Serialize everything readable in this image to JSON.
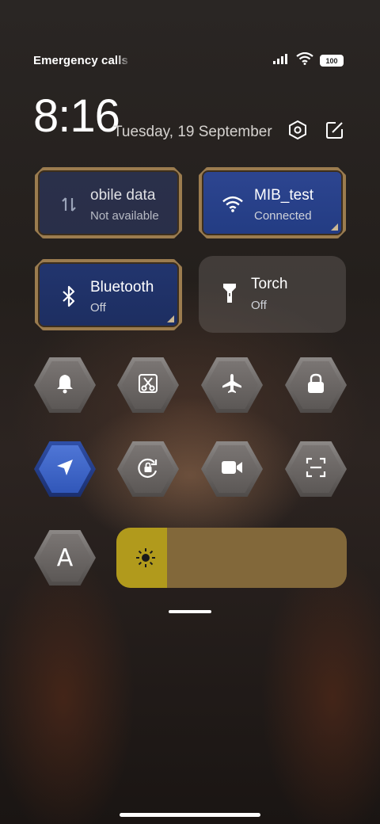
{
  "status_bar": {
    "carrier_text": "Emergency calls o",
    "battery_level": "100"
  },
  "header": {
    "time": "8:16",
    "date": "Tuesday, 19 September"
  },
  "tiles": {
    "mobile_data": {
      "title": "obile data",
      "subtitle": "Not available"
    },
    "wifi": {
      "title": "MIB_test",
      "subtitle": "Connected"
    },
    "bluetooth": {
      "title": "Bluetooth",
      "subtitle": "Off"
    },
    "torch": {
      "title": "Torch",
      "subtitle": "Off"
    }
  },
  "toggles": [
    {
      "icon": "bell-icon",
      "active": false
    },
    {
      "icon": "screenshot-scissors-icon",
      "active": false
    },
    {
      "icon": "airplane-icon",
      "active": false
    },
    {
      "icon": "lock-icon",
      "active": false
    },
    {
      "icon": "location-icon",
      "active": true
    },
    {
      "icon": "rotation-lock-icon",
      "active": false
    },
    {
      "icon": "video-camera-icon",
      "active": false
    },
    {
      "icon": "scan-icon",
      "active": false
    }
  ],
  "auto_brightness_label": "A",
  "brightness": {
    "level": 0.22,
    "icon": "sun-icon"
  },
  "colors": {
    "active_blue": "#2d4590",
    "frame_gold": "#9b7c4f",
    "brightness_fill": "#b19a1c",
    "brightness_track": "#82683a"
  }
}
